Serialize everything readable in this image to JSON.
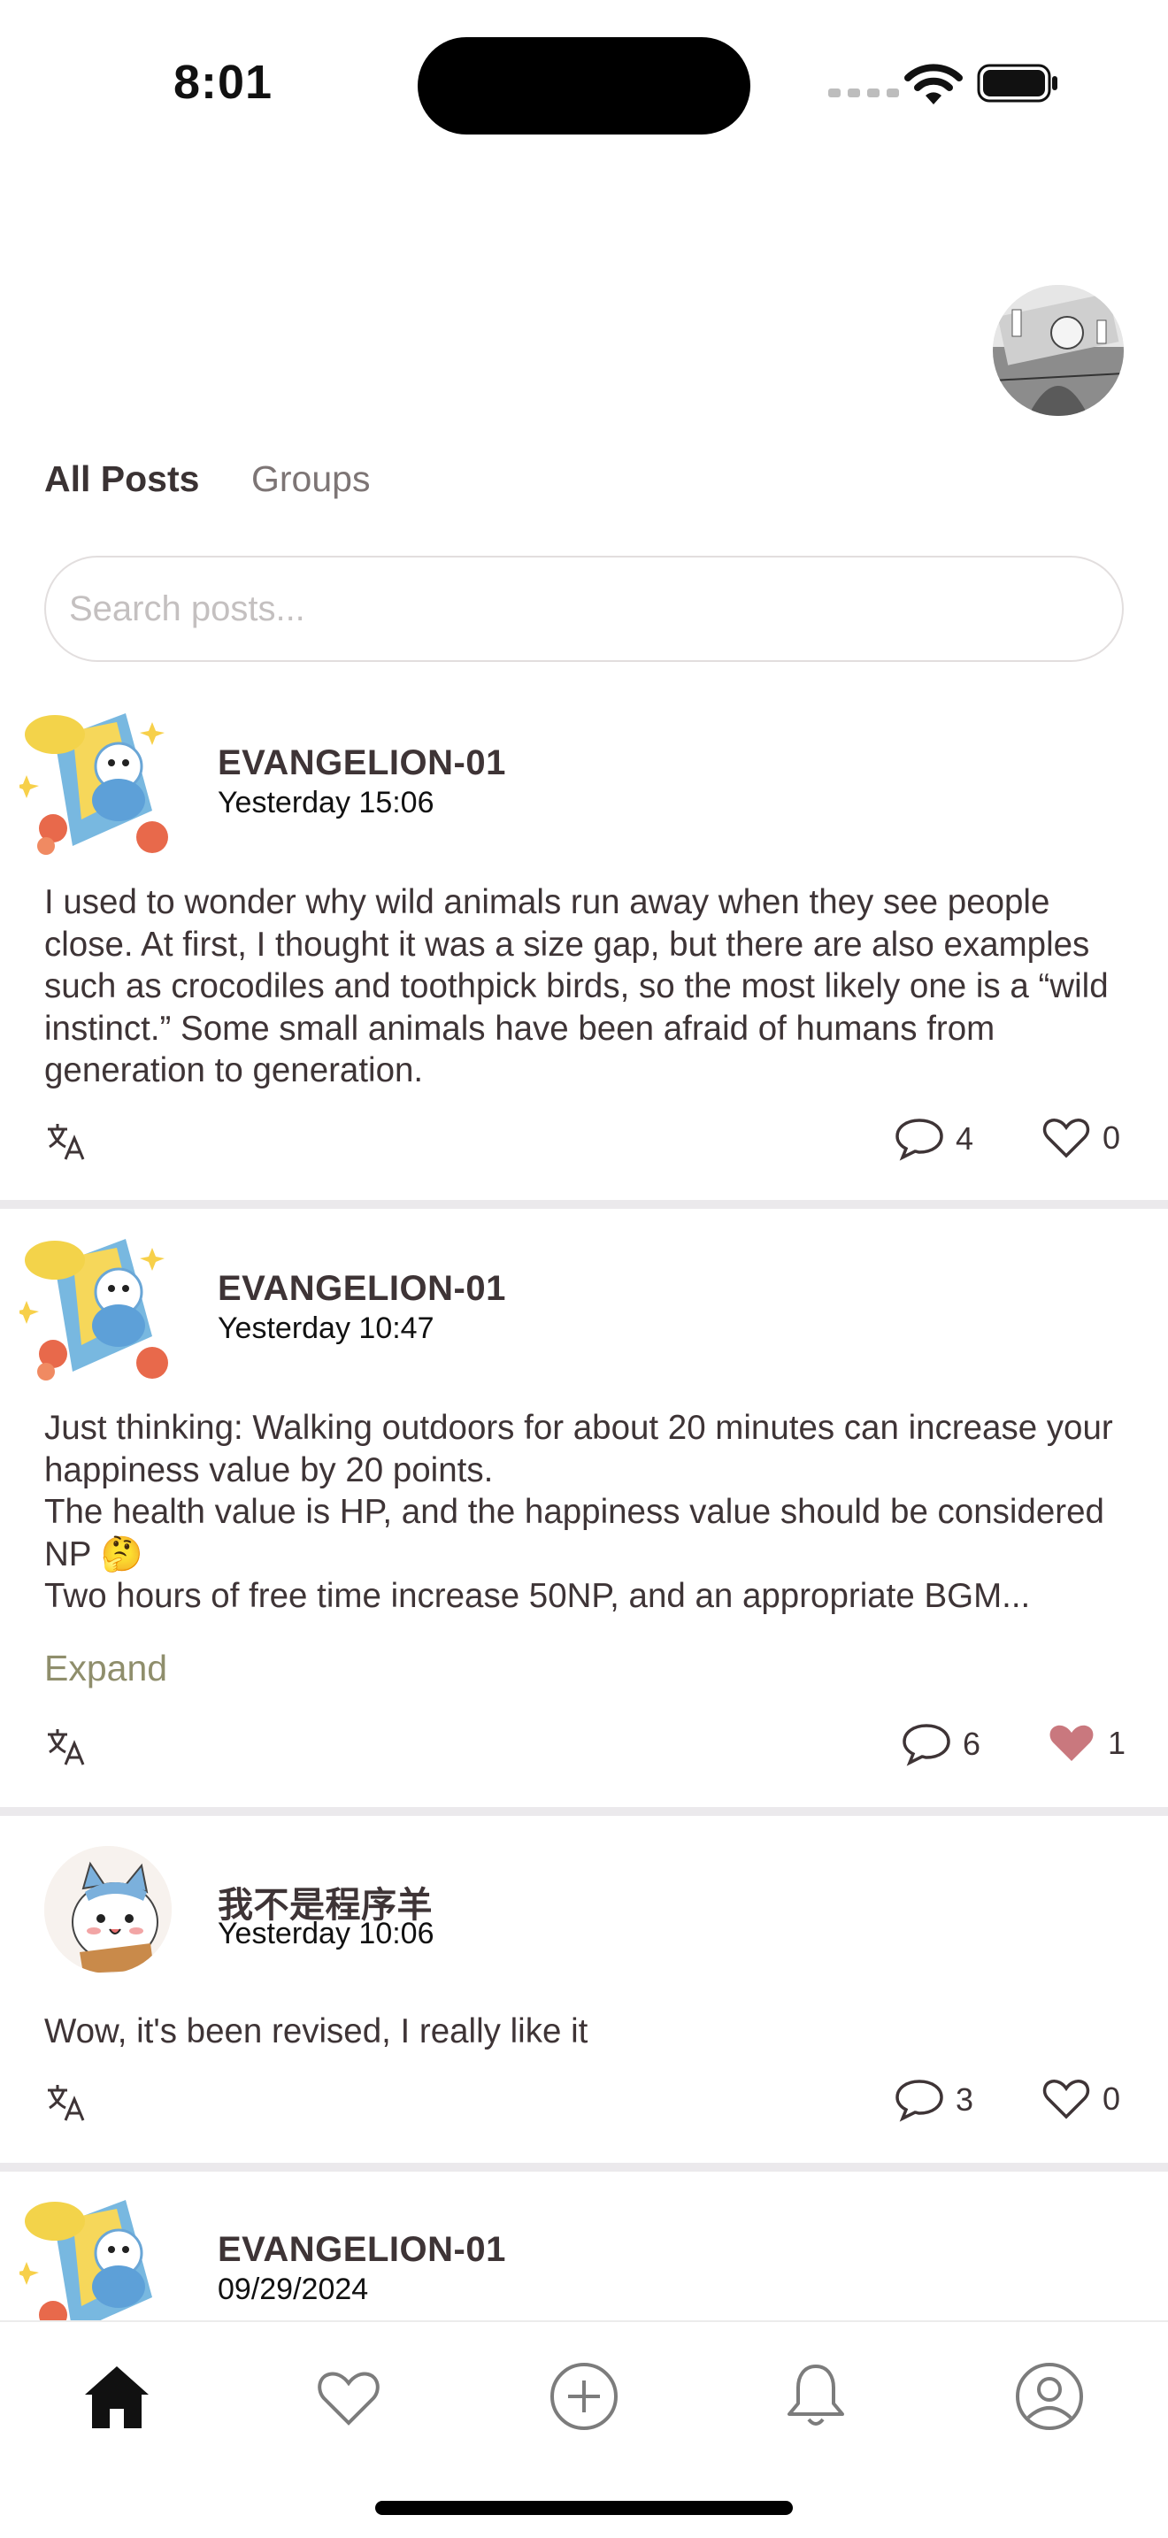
{
  "status_bar": {
    "time": "8:01"
  },
  "tabs": [
    {
      "label": "All Posts",
      "active": true
    },
    {
      "label": "Groups",
      "active": false
    }
  ],
  "search": {
    "placeholder": "Search posts..."
  },
  "posts": [
    {
      "author": "EVANGELION-01",
      "time": "Yesterday 15:06",
      "body": [
        "I used to wonder why wild animals run away when they see people close. At first, I thought it was a size gap, but there are also examples such as crocodiles and toothpick birds, so the most likely one is a “wild instinct.” Some small animals have been afraid of humans from generation to generation."
      ],
      "comments": "4",
      "likes": "0",
      "liked": false
    },
    {
      "author": "EVANGELION-01",
      "time": "Yesterday 10:47",
      "body": [
        "Just thinking: Walking outdoors for about 20 minutes can increase your happiness value by 20 points.",
        "The health value is HP, and the happiness value should be considered NP 🤔",
        "Two hours of free time increase 50NP, and an appropriate BGM..."
      ],
      "expand_label": "Expand",
      "comments": "6",
      "likes": "1",
      "liked": true
    },
    {
      "author": "我不是程序羊",
      "time": "Yesterday 10:06",
      "body": [
        "Wow, it's been revised, I really like it"
      ],
      "comments": "3",
      "likes": "0",
      "liked": false
    },
    {
      "author": "EVANGELION-01",
      "time": "09/29/2024"
    }
  ],
  "colors": {
    "accent": "#8f8e6c",
    "like_active": "#c9787e",
    "text": "#3e3436"
  },
  "bottom_nav": [
    "home-icon",
    "heart-icon",
    "add-icon",
    "bell-icon",
    "profile-icon"
  ]
}
